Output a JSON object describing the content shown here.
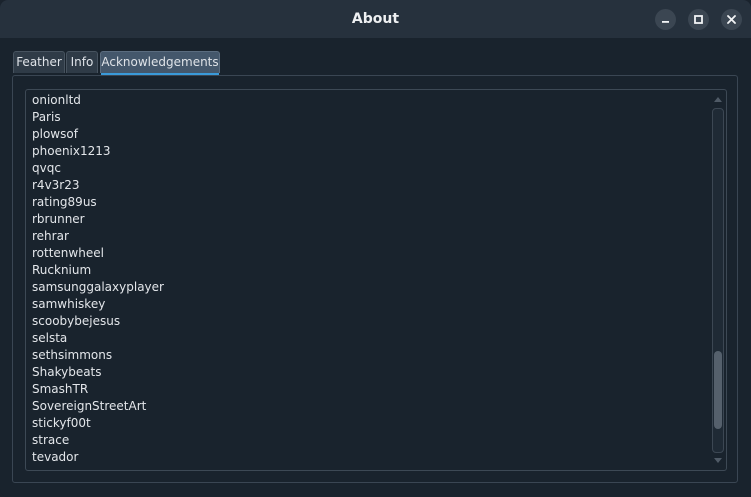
{
  "window": {
    "title": "About",
    "controls": [
      "minimize-icon",
      "maximize-icon",
      "close-icon"
    ]
  },
  "tabs": [
    {
      "label": "Feather",
      "active": false
    },
    {
      "label": "Info",
      "active": false
    },
    {
      "label": "Acknowledgements",
      "active": true
    }
  ],
  "acknowledgements": {
    "visible_names": [
      "onionltd",
      "Paris",
      "plowsof",
      "phoenix1213",
      "qvqc",
      "r4v3r23",
      "rating89us",
      "rbrunner",
      "rehrar",
      "rottenwheel",
      "Rucknium",
      "samsunggalaxyplayer",
      "samwhiskey",
      "scoobybejesus",
      "selsta",
      "sethsimmons",
      "Shakybeats",
      "SmashTR",
      "SovereignStreetArt",
      "stickyf00t",
      "strace",
      "tevador"
    ],
    "scroll_position_fraction": 0.92
  },
  "colors": {
    "background": "#19232d",
    "titlebar": "#26313d",
    "accent": "#3a9ad9",
    "text": "#dfe3e8"
  }
}
